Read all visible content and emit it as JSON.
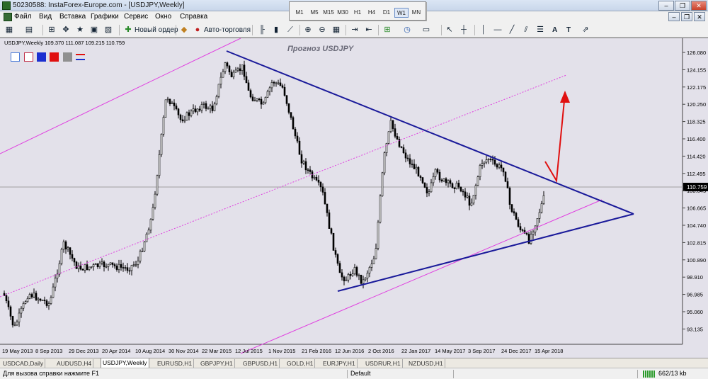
{
  "window": {
    "title": "50230588: InstaForex-Europe.com - [USDJPY,Weekly]",
    "minimize": "–",
    "restore": "❐",
    "close": "✕"
  },
  "menu": [
    "Файл",
    "Вид",
    "Вставка",
    "Графики",
    "Сервис",
    "Окно",
    "Справка"
  ],
  "timeframes": [
    "M1",
    "M5",
    "M15",
    "M30",
    "H1",
    "H4",
    "D1",
    "W1",
    "MN"
  ],
  "active_timeframe": "W1",
  "toolbar": {
    "new_order": "Новый ордер",
    "autotrading": "Авто-торговля",
    "text_tool": "A",
    "label_tool": "T"
  },
  "chart": {
    "header": "USDJPY,Weekly  109.370 111.087 109.215 110.759",
    "annotation": "Прогноз USDJPY",
    "current_price": "110.759",
    "color_boxes": [
      "#4a7bd8",
      "#c0304a",
      "#1b2fd0",
      "#e01010",
      "#909090"
    ],
    "price_labels": [
      "126.080",
      "124.155",
      "122.175",
      "120.250",
      "118.325",
      "116.400",
      "114.420",
      "112.495",
      "108.645",
      "106.665",
      "104.740",
      "102.815",
      "100.890",
      "98.910",
      "96.985",
      "95.060",
      "93.135"
    ],
    "date_labels": [
      "19 May 2013",
      "8 Sep 2013",
      "29 Dec 2013",
      "20 Apr 2014",
      "10 Aug 2014",
      "30 Nov 2014",
      "22 Mar 2015",
      "12 Jul 2015",
      "1 Nov 2015",
      "21 Feb 2016",
      "12 Jun 2016",
      "2 Oct 2016",
      "22 Jan 2017",
      "14 May 2017",
      "3 Sep 2017",
      "24 Dec 2017",
      "15 Apr 2018"
    ],
    "colors": {
      "background": "#e3e1ea",
      "candles": "#000000",
      "triangle": "#1a1a9a",
      "channel": "#e040e0",
      "forecast": "#e01010"
    }
  },
  "tabs": [
    "USDCAD,Daily",
    "AUDUSD,H4",
    "USDJPY,Weekly",
    "EURUSD,H1",
    "GBPJPY,H1",
    "GBPUSD,H1",
    "GOLD,H1",
    "EURJPY,H1",
    "USDRUR,H1",
    "NZDUSD,H1"
  ],
  "active_tab": "USDJPY,Weekly",
  "status": {
    "help": "Для вызова справки нажмите F1",
    "profile": "Default",
    "traffic": "662/13 kb"
  }
}
